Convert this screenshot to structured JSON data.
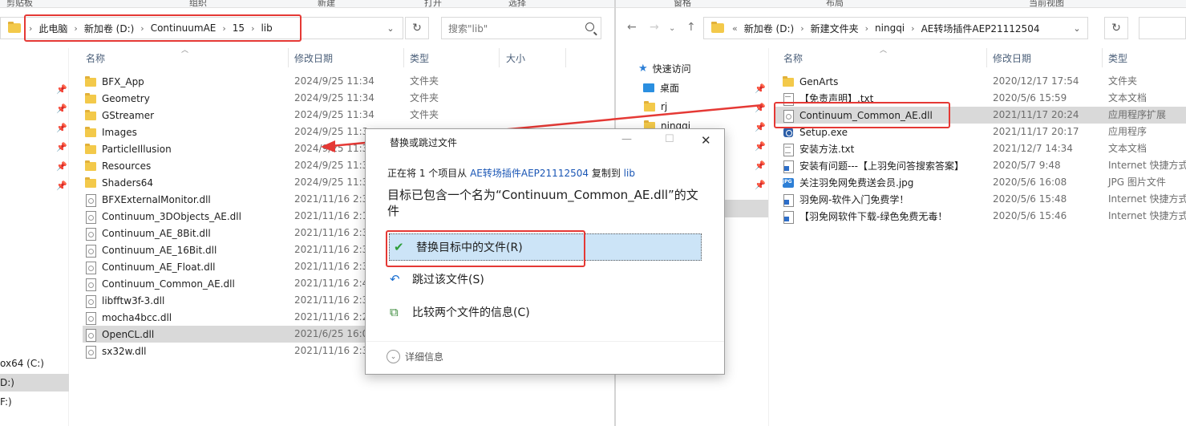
{
  "left": {
    "ribbon": [
      "剪贴板",
      "组织",
      "新建",
      "打开",
      "选择"
    ],
    "breadcrumb": [
      "此电脑",
      "新加卷 (D:)",
      "ContinuumAE",
      "15",
      "lib"
    ],
    "search_placeholder": "搜索\"lib\"",
    "columns": [
      "名称",
      "修改日期",
      "类型",
      "大小"
    ],
    "drives": [
      "ox64 (C:)",
      "D:)",
      "F:)"
    ],
    "files": [
      {
        "name": "BFX_App",
        "date": "2024/9/25 11:34",
        "type": "文件夹",
        "icon": "folder-icon"
      },
      {
        "name": "Geometry",
        "date": "2024/9/25 11:34",
        "type": "文件夹",
        "icon": "folder-icon"
      },
      {
        "name": "GStreamer",
        "date": "2024/9/25 11:34",
        "type": "文件夹",
        "icon": "folder-icon"
      },
      {
        "name": "Images",
        "date": "2024/9/25 11:3",
        "type": "",
        "icon": "folder-icon"
      },
      {
        "name": "ParticleIllusion",
        "date": "2024/9/25 11:3",
        "type": "",
        "icon": "folder-icon"
      },
      {
        "name": "Resources",
        "date": "2024/9/25 11:3",
        "type": "",
        "icon": "folder-icon"
      },
      {
        "name": "Shaders64",
        "date": "2024/9/25 11:3",
        "type": "",
        "icon": "folder-icon"
      },
      {
        "name": "BFXExternalMonitor.dll",
        "date": "2021/11/16 2:3",
        "type": "",
        "icon": "dll-file-icon"
      },
      {
        "name": "Continuum_3DObjects_AE.dll",
        "date": "2021/11/16 2:1",
        "type": "",
        "icon": "dll-file-icon"
      },
      {
        "name": "Continuum_AE_8Bit.dll",
        "date": "2021/11/16 2:3",
        "type": "",
        "icon": "dll-file-icon"
      },
      {
        "name": "Continuum_AE_16Bit.dll",
        "date": "2021/11/16 2:3",
        "type": "",
        "icon": "dll-file-icon"
      },
      {
        "name": "Continuum_AE_Float.dll",
        "date": "2021/11/16 2:3",
        "type": "",
        "icon": "dll-file-icon"
      },
      {
        "name": "Continuum_Common_AE.dll",
        "date": "2021/11/16 2:4",
        "type": "",
        "icon": "dll-file-icon"
      },
      {
        "name": "libfftw3f-3.dll",
        "date": "2021/11/16 2:3",
        "type": "",
        "icon": "dll-file-icon"
      },
      {
        "name": "mocha4bcc.dll",
        "date": "2021/11/16 2:2",
        "type": "",
        "icon": "dll-file-icon"
      },
      {
        "name": "OpenCL.dll",
        "date": "2021/6/25 16:0",
        "type": "",
        "icon": "dll-file-icon"
      },
      {
        "name": "sx32w.dll",
        "date": "2021/11/16 2:3",
        "type": "",
        "icon": "dll-file-icon"
      }
    ]
  },
  "right": {
    "ribbon": [
      "窗格",
      "布局",
      "当前视图"
    ],
    "breadcrumb_prefix": "«",
    "breadcrumb": [
      "新加卷 (D:)",
      "新建文件夹",
      "ningqi",
      "AE转场插件AEP21112504"
    ],
    "columns": [
      "名称",
      "修改日期",
      "类型"
    ],
    "quick_access": [
      {
        "label": "快速访问",
        "icon": "star-icon"
      },
      {
        "label": "桌面",
        "icon": "desktop-icon"
      },
      {
        "label": "rj",
        "icon": "folder-icon"
      },
      {
        "label": "ningqi",
        "icon": "folder-icon"
      }
    ],
    "files": [
      {
        "name": "GenArts",
        "date": "2020/12/17 17:54",
        "type": "文件夹",
        "icon": "folder-icon"
      },
      {
        "name": "【免责声明】.txt",
        "date": "2020/5/6 15:59",
        "type": "文本文档",
        "icon": "text-file-icon"
      },
      {
        "name": "Continuum_Common_AE.dll",
        "date": "2021/11/17 20:24",
        "type": "应用程序扩展",
        "icon": "dll-file-icon"
      },
      {
        "name": "Setup.exe",
        "date": "2021/11/17 20:17",
        "type": "应用程序",
        "icon": "exe-icon"
      },
      {
        "name": "安装方法.txt",
        "date": "2021/12/7 14:34",
        "type": "文本文档",
        "icon": "text-file-icon"
      },
      {
        "name": "安装有问题---【上羽免问答搜索答案】",
        "date": "2020/5/7 9:48",
        "type": "Internet 快捷方式",
        "icon": "shortcut-icon"
      },
      {
        "name": "关注羽免网免费送会员.jpg",
        "date": "2020/5/6 16:08",
        "type": "JPG 图片文件",
        "icon": "jpg-icon"
      },
      {
        "name": "羽免网-软件入门免费学！",
        "date": "2020/5/6 15:48",
        "type": "Internet 快捷方式",
        "icon": "shortcut-icon"
      },
      {
        "name": "【羽免网软件下载-绿色免费无毒！",
        "date": "2020/5/6 15:46",
        "type": "Internet 快捷方式",
        "icon": "shortcut-icon"
      }
    ]
  },
  "dialog": {
    "title": "替换或跳过文件",
    "progress_prefix": "正在将 1 个项目从",
    "source": "AE转场插件AEP21112504",
    "progress_mid": "复制到",
    "dest": "lib",
    "message": "目标已包含一个名为“Continuum_Common_AE.dll”的文件",
    "replace": "替换目标中的文件(R)",
    "skip": "跳过该文件(S)",
    "compare": "比较两个文件的信息(C)",
    "details": "详细信息"
  }
}
